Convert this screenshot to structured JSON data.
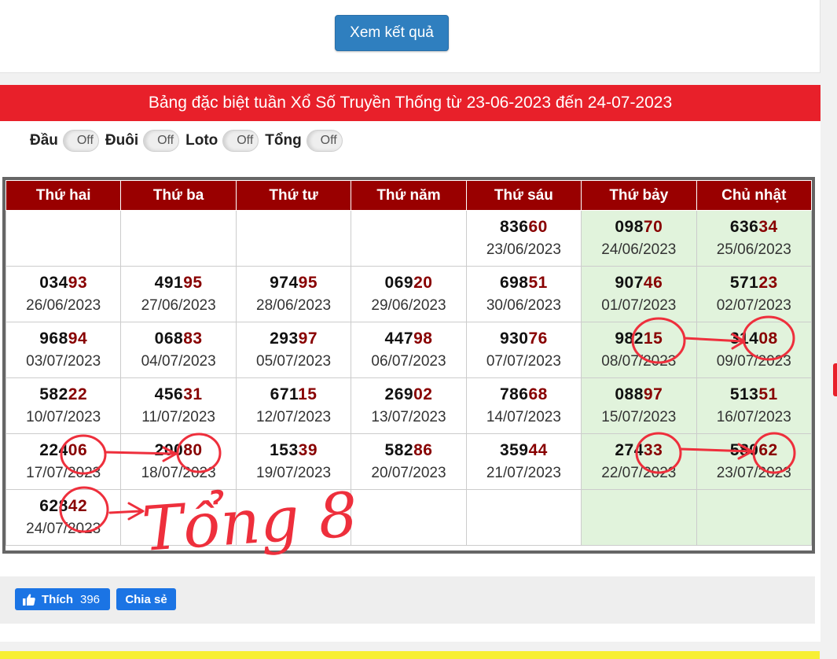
{
  "view_button": "Xem kết quả",
  "title": "Bảng đặc biệt tuần Xổ Số Truyền Thống từ 23-06-2023 đến 24-07-2023",
  "filters": [
    {
      "label": "Đầu",
      "state": "Off"
    },
    {
      "label": "Đuôi",
      "state": "Off"
    },
    {
      "label": "Loto",
      "state": "Off"
    },
    {
      "label": "Tổng",
      "state": "Off"
    }
  ],
  "headers": [
    "Thứ hai",
    "Thứ ba",
    "Thứ tư",
    "Thứ năm",
    "Thứ sáu",
    "Thứ bảy",
    "Chủ nhật"
  ],
  "weeks": [
    [
      {
        "head": "",
        "tail": "",
        "date": ""
      },
      {
        "head": "",
        "tail": "",
        "date": ""
      },
      {
        "head": "",
        "tail": "",
        "date": ""
      },
      {
        "head": "",
        "tail": "",
        "date": ""
      },
      {
        "head": "836",
        "tail": "60",
        "date": "23/06/2023"
      },
      {
        "head": "098",
        "tail": "70",
        "date": "24/06/2023"
      },
      {
        "head": "636",
        "tail": "34",
        "date": "25/06/2023"
      }
    ],
    [
      {
        "head": "034",
        "tail": "93",
        "date": "26/06/2023"
      },
      {
        "head": "491",
        "tail": "95",
        "date": "27/06/2023"
      },
      {
        "head": "974",
        "tail": "95",
        "date": "28/06/2023"
      },
      {
        "head": "069",
        "tail": "20",
        "date": "29/06/2023"
      },
      {
        "head": "698",
        "tail": "51",
        "date": "30/06/2023"
      },
      {
        "head": "907",
        "tail": "46",
        "date": "01/07/2023"
      },
      {
        "head": "571",
        "tail": "23",
        "date": "02/07/2023"
      }
    ],
    [
      {
        "head": "968",
        "tail": "94",
        "date": "03/07/2023"
      },
      {
        "head": "068",
        "tail": "83",
        "date": "04/07/2023"
      },
      {
        "head": "293",
        "tail": "97",
        "date": "05/07/2023"
      },
      {
        "head": "447",
        "tail": "98",
        "date": "06/07/2023"
      },
      {
        "head": "930",
        "tail": "76",
        "date": "07/07/2023"
      },
      {
        "head": "982",
        "tail": "15",
        "date": "08/07/2023"
      },
      {
        "head": "314",
        "tail": "08",
        "date": "09/07/2023"
      }
    ],
    [
      {
        "head": "582",
        "tail": "22",
        "date": "10/07/2023"
      },
      {
        "head": "456",
        "tail": "31",
        "date": "11/07/2023"
      },
      {
        "head": "671",
        "tail": "15",
        "date": "12/07/2023"
      },
      {
        "head": "269",
        "tail": "02",
        "date": "13/07/2023"
      },
      {
        "head": "786",
        "tail": "68",
        "date": "14/07/2023"
      },
      {
        "head": "088",
        "tail": "97",
        "date": "15/07/2023"
      },
      {
        "head": "513",
        "tail": "51",
        "date": "16/07/2023"
      }
    ],
    [
      {
        "head": "224",
        "tail": "06",
        "date": "17/07/2023"
      },
      {
        "head": "200",
        "tail": "80",
        "date": "18/07/2023"
      },
      {
        "head": "153",
        "tail": "39",
        "date": "19/07/2023"
      },
      {
        "head": "582",
        "tail": "86",
        "date": "20/07/2023"
      },
      {
        "head": "359",
        "tail": "44",
        "date": "21/07/2023"
      },
      {
        "head": "274",
        "tail": "33",
        "date": "22/07/2023"
      },
      {
        "head": "580",
        "tail": "62",
        "date": "23/07/2023"
      }
    ],
    [
      {
        "head": "628",
        "tail": "42",
        "date": "24/07/2023"
      },
      {
        "head": "",
        "tail": "",
        "date": ""
      },
      {
        "head": "",
        "tail": "",
        "date": ""
      },
      {
        "head": "",
        "tail": "",
        "date": ""
      },
      {
        "head": "",
        "tail": "",
        "date": ""
      },
      {
        "head": "",
        "tail": "",
        "date": ""
      },
      {
        "head": "",
        "tail": "",
        "date": ""
      }
    ]
  ],
  "share": {
    "like_label": "Thích",
    "like_count": "396",
    "share_label": "Chia sẻ"
  },
  "annotation": {
    "text": "Tổng 8",
    "color": "#ee2f3c"
  }
}
